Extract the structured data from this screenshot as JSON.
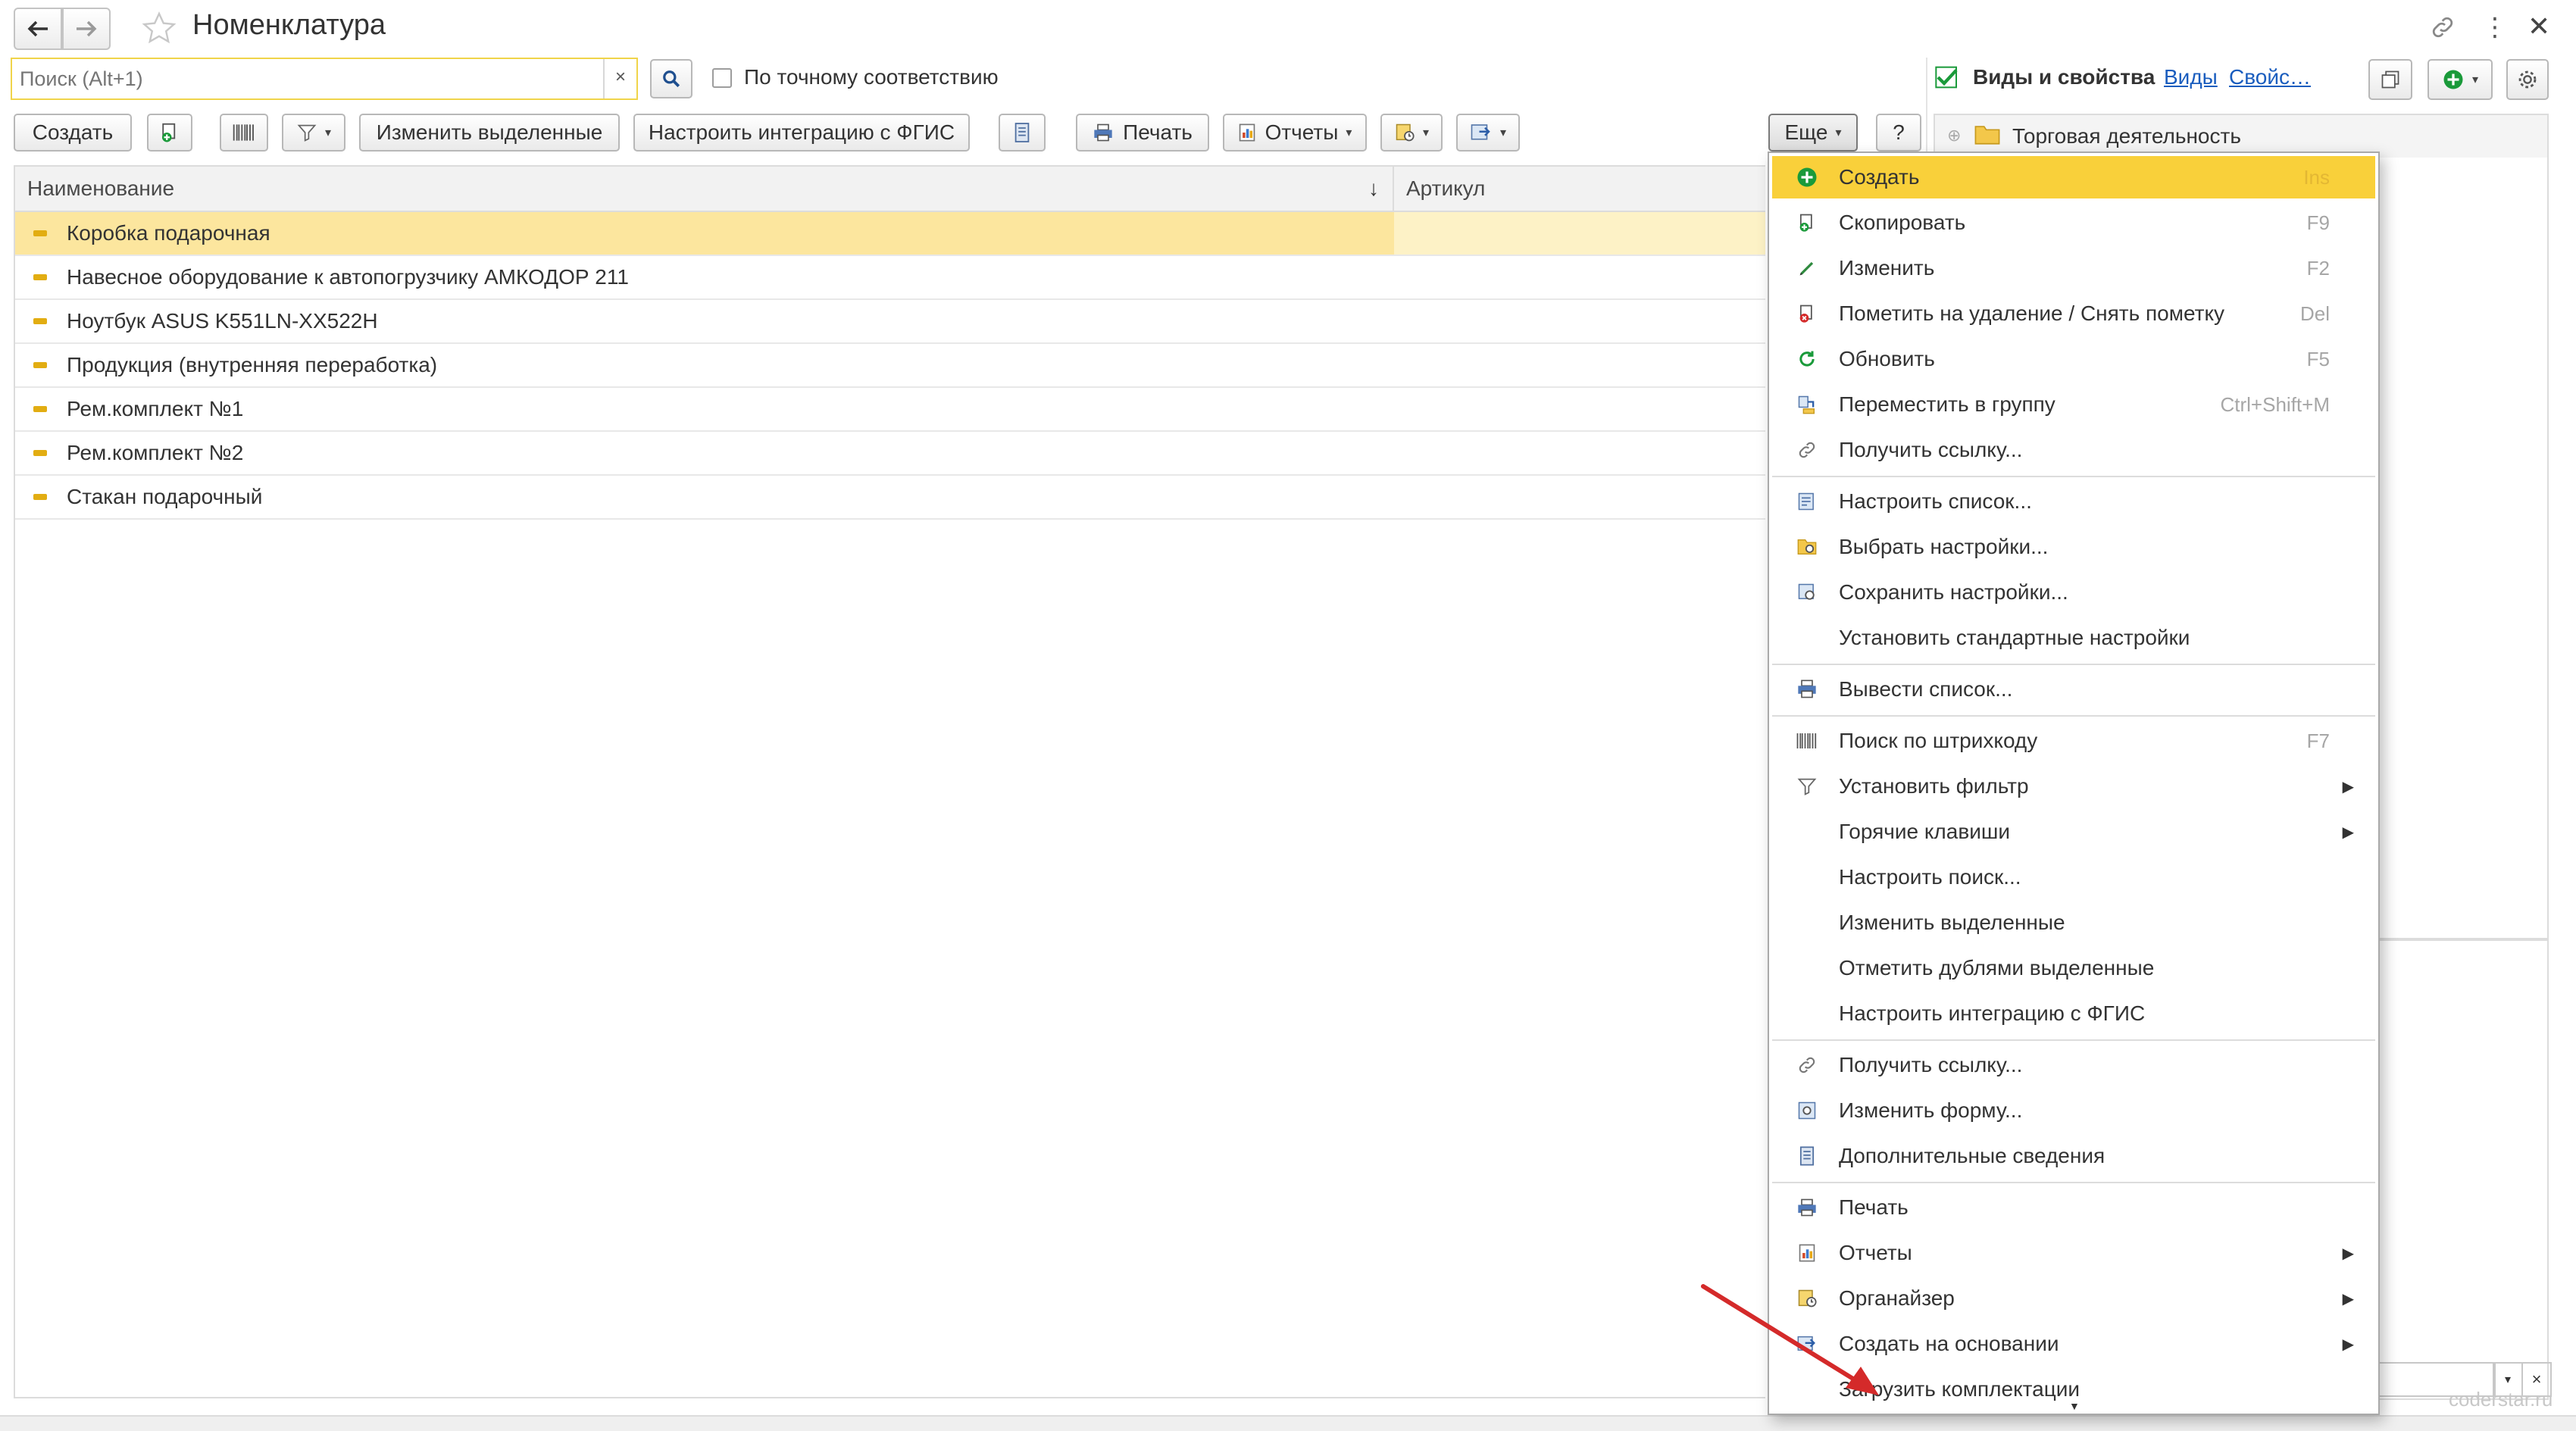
{
  "window": {
    "title": "Номенклатура",
    "back_icon": "arrow-left-icon",
    "forward_icon": "arrow-right-icon",
    "favorite_icon": "star-icon",
    "link_icon": "link-icon",
    "more_icon": "vertical-dots-icon",
    "close_icon": "close-icon"
  },
  "search": {
    "placeholder": "Поиск (Alt+1)",
    "value": "",
    "clear_label": "×",
    "exact_match_label": "По точному соответствию",
    "exact_match_checked": false
  },
  "toolbar": {
    "create_label": "Создать",
    "change_selected_label": "Изменить выделенные",
    "configure_fgis_label": "Настроить интеграцию с ФГИС",
    "print_label": "Печать",
    "reports_label": "Отчеты",
    "more_label": "Еще",
    "help_label": "?"
  },
  "right_panel": {
    "types_label": "Виды и свойства",
    "types_checked": true,
    "link_views": "Виды",
    "link_props": "Свойс…",
    "tree_item": "Торговая деятельность"
  },
  "table": {
    "columns": [
      "Наименование",
      "Артикул"
    ],
    "sort_indicator": "↓",
    "rows": [
      {
        "name": "Коробка подарочная",
        "selected": true
      },
      {
        "name": "Навесное оборудование к автопогрузчику АМКОДОР 211",
        "selected": false
      },
      {
        "name": "Ноутбук ASUS K551LN-XX522H",
        "selected": false
      },
      {
        "name": "Продукция (внутренняя переработка)",
        "selected": false
      },
      {
        "name": "Рем.комплект №1",
        "selected": false
      },
      {
        "name": "Рем.комплект №2",
        "selected": false
      },
      {
        "name": "Стакан подарочный",
        "selected": false
      }
    ]
  },
  "menu": {
    "items": [
      {
        "label": "Создать",
        "key": "Ins",
        "icon": "plus-circle-icon",
        "highlighted": true
      },
      {
        "label": "Скопировать",
        "key": "F9",
        "icon": "copy-icon"
      },
      {
        "label": "Изменить",
        "key": "F2",
        "icon": "pencil-icon"
      },
      {
        "label": "Пометить на удаление / Снять пометку",
        "key": "Del",
        "icon": "delete-mark-icon"
      },
      {
        "label": "Обновить",
        "key": "F5",
        "icon": "refresh-icon"
      },
      {
        "label": "Переместить в группу",
        "key": "Ctrl+Shift+M",
        "icon": "move-to-group-icon"
      },
      {
        "label": "Получить ссылку...",
        "key": "",
        "icon": "link-icon"
      },
      {
        "label": "Настроить список...",
        "key": "",
        "icon": "list-settings-icon"
      },
      {
        "label": "Выбрать настройки...",
        "key": "",
        "icon": "select-settings-icon"
      },
      {
        "label": "Сохранить настройки...",
        "key": "",
        "icon": "save-settings-icon"
      },
      {
        "label": "Установить стандартные настройки",
        "key": "",
        "icon": ""
      },
      {
        "label": "Вывести список...",
        "key": "",
        "icon": "output-list-icon"
      },
      {
        "label": "Поиск по штрихкоду",
        "key": "F7",
        "icon": "barcode-icon"
      },
      {
        "label": "Установить фильтр",
        "key": "",
        "icon": "filter-icon",
        "submenu": true
      },
      {
        "label": "Горячие клавиши",
        "key": "",
        "icon": "",
        "submenu": true
      },
      {
        "label": "Настроить поиск...",
        "key": "",
        "icon": ""
      },
      {
        "label": "Изменить выделенные",
        "key": "",
        "icon": ""
      },
      {
        "label": "Отметить дублями выделенные",
        "key": "",
        "icon": ""
      },
      {
        "label": "Настроить интеграцию с ФГИС",
        "key": "",
        "icon": ""
      },
      {
        "label": "Получить ссылку...",
        "key": "",
        "icon": "link-icon"
      },
      {
        "label": "Изменить форму...",
        "key": "",
        "icon": "change-form-icon"
      },
      {
        "label": "Дополнительные сведения",
        "key": "",
        "icon": "additional-info-icon"
      },
      {
        "label": "Печать",
        "key": "",
        "icon": "printer-icon"
      },
      {
        "label": "Отчеты",
        "key": "",
        "icon": "reports-icon",
        "submenu": true
      },
      {
        "label": "Органайзер",
        "key": "",
        "icon": "organizer-icon",
        "submenu": true
      },
      {
        "label": "Создать на основании",
        "key": "",
        "icon": "create-based-icon",
        "submenu": true
      },
      {
        "label": "Загрузить комплектации",
        "key": "",
        "icon": ""
      }
    ]
  },
  "watermark": "coderstar.ru",
  "colors": {
    "highlight": "#f9d03a",
    "selected_row": "#fce69e",
    "accent_green": "#1a9a3a",
    "link_blue": "#1a5dbe",
    "arrow_red": "#d42a2a"
  }
}
